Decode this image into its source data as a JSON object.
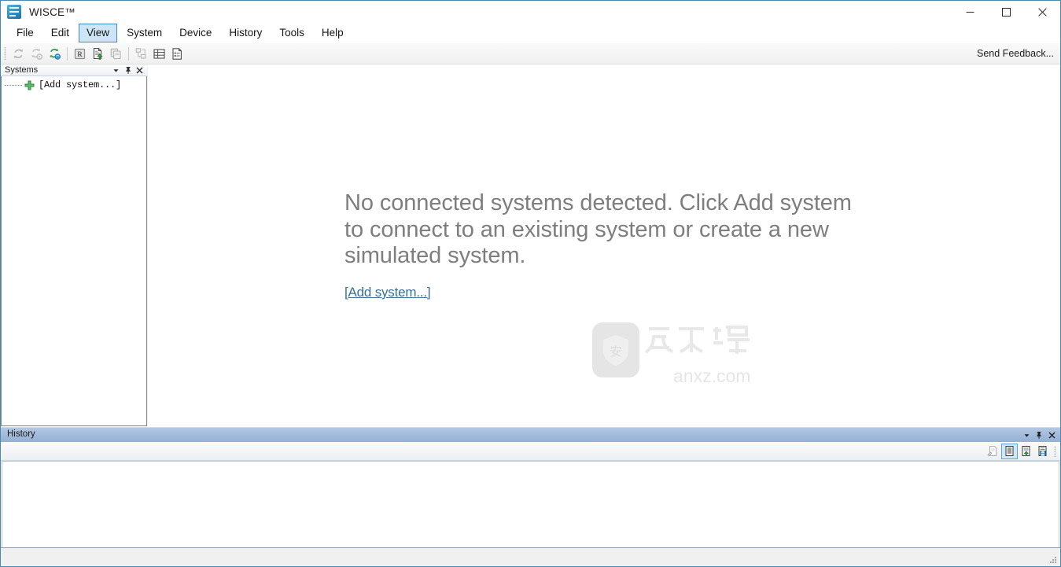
{
  "window": {
    "title": "WISCE™",
    "app_icon": "wisce-app-icon",
    "minimize_label": "Minimize",
    "maximize_label": "Maximize",
    "close_label": "Close"
  },
  "menubar": {
    "items": [
      {
        "label": "File",
        "active": false
      },
      {
        "label": "Edit",
        "active": false
      },
      {
        "label": "View",
        "active": true
      },
      {
        "label": "System",
        "active": false
      },
      {
        "label": "Device",
        "active": false
      },
      {
        "label": "History",
        "active": false
      },
      {
        "label": "Tools",
        "active": false
      },
      {
        "label": "Help",
        "active": false
      }
    ]
  },
  "toolbar": {
    "send_feedback_label": "Send Feedback...",
    "buttons": [
      {
        "name": "refresh-icon",
        "state": "disabled"
      },
      {
        "name": "refresh-settings-icon",
        "state": "disabled"
      },
      {
        "name": "refresh-sync-icon",
        "state": "enabled"
      },
      {
        "name": "register-icon",
        "state": "enabled"
      },
      {
        "name": "document-export-icon",
        "state": "enabled"
      },
      {
        "name": "copy-registers-icon",
        "state": "disabled"
      },
      {
        "name": "device-tree-icon",
        "state": "disabled"
      },
      {
        "name": "table-view-icon",
        "state": "enabled"
      },
      {
        "name": "report-icon",
        "state": "enabled"
      }
    ]
  },
  "systems_panel": {
    "title": "Systems",
    "menu_icon": "chevron-down-icon",
    "pin_icon": "pin-icon",
    "close_icon": "close-icon",
    "tree": [
      {
        "label": "[Add system...]",
        "icon": "green-plus-icon"
      }
    ]
  },
  "main": {
    "empty_message": "No connected systems detected. Click Add system to connect to an existing system or create a new simulated system.",
    "add_system_link": "[Add system...]"
  },
  "watermark": {
    "brand_cn": "安下载",
    "badge_char": "安",
    "domain": "anxz.com"
  },
  "history_panel": {
    "title": "History",
    "menu_icon": "chevron-down-icon",
    "pin_icon": "pin-icon",
    "close_icon": "close-icon",
    "toolbar_buttons": [
      {
        "name": "history-annotate-icon",
        "state": "disabled",
        "selected": false
      },
      {
        "name": "history-list-icon",
        "state": "enabled",
        "selected": true
      },
      {
        "name": "history-export-icon",
        "state": "enabled",
        "selected": false
      },
      {
        "name": "history-save-icon",
        "state": "enabled",
        "selected": false
      }
    ],
    "log_entries": []
  },
  "statusbar": {
    "text": "",
    "resize_grip": "resize-grip-icon"
  },
  "colors": {
    "accent": "#3c8dbc",
    "menu_highlight": "#cde6f7",
    "history_header_top": "#b2c8e3",
    "history_header_bottom": "#93b0d4",
    "link": "#376f9b",
    "empty_text": "#7e7e7e",
    "window_border": "#4a8ab0"
  }
}
